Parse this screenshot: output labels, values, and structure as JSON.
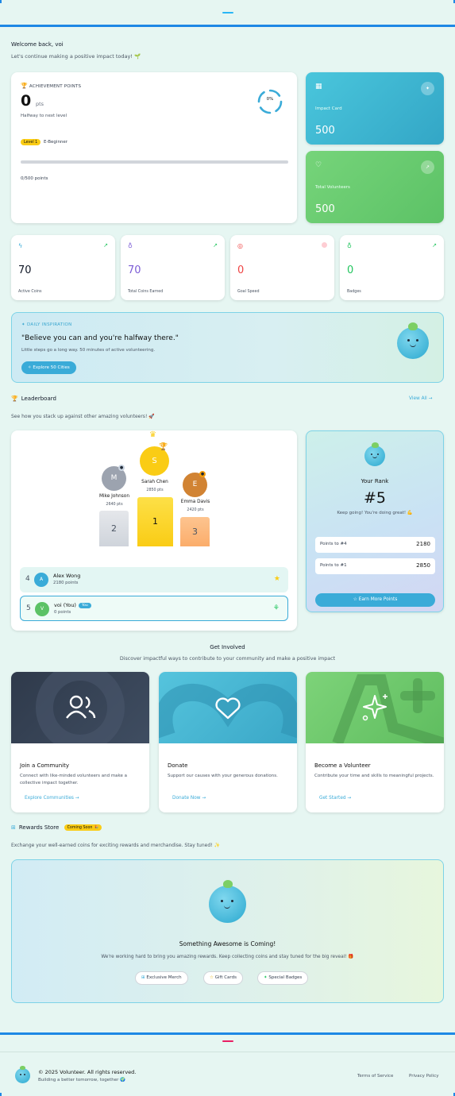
{
  "header": {},
  "welcome": {
    "title": "Welcome back, voi",
    "subtitle": "Let's continue making a positive impact today! 🌱"
  },
  "achievement": {
    "label": "ACHIEVEMENT POINTS",
    "value": "0",
    "unit": "pts",
    "caption": "Halfway to next level",
    "ring_text": "0%",
    "level_badge": "Level 1",
    "level_name": "E-Beginner",
    "progress_fraction": 0,
    "progress_text": "0/500 points"
  },
  "impact_card": {
    "label": "Impact Card",
    "value": "500"
  },
  "volunteers_card": {
    "label": "Total Volunteers",
    "value": "500"
  },
  "stats": [
    {
      "label": "Active Coins",
      "value": "70",
      "icon": "bolt-icon",
      "color": "#111827"
    },
    {
      "label": "Total Coins Earned",
      "value": "70",
      "icon": "medal-icon",
      "color": "#7c5cd6"
    },
    {
      "label": "Goal Speed",
      "value": "0",
      "icon": "target-icon",
      "color": "#ef4444"
    },
    {
      "label": "Badges",
      "value": "0",
      "icon": "award-icon",
      "color": "#22c55e"
    }
  ],
  "inspiration": {
    "tag": "DAILY INSPIRATION",
    "quote": "\"Believe you can and you're halfway there.\"",
    "subtext": "Little steps go a long way. 50 minutes of active volunteering.",
    "button": "Explore 50 Cities"
  },
  "leaderboard": {
    "title": "Leaderboard",
    "view_all": "View All",
    "subtitle": "See how you stack up against other amazing volunteers! 🚀",
    "podium": [
      {
        "initial": "M",
        "name": "Mike Johnson",
        "points": "2640 pts",
        "rank": "2"
      },
      {
        "initial": "S",
        "name": "Sarah Chen",
        "points": "2850 pts",
        "rank": "1"
      },
      {
        "initial": "E",
        "name": "Emma Davis",
        "points": "2420 pts",
        "rank": "3"
      }
    ],
    "rows": [
      {
        "rank": "4",
        "initial": "A",
        "name": "Alex Wong",
        "points": "2180 points"
      },
      {
        "rank": "5",
        "initial": "V",
        "name": "voi (You)",
        "points": "0 points",
        "badge": "You"
      }
    ]
  },
  "your_rank": {
    "title": "Your Rank",
    "rank": "#5",
    "message": "Keep going! You're doing great! 💪",
    "to4_label": "Points to #4",
    "to4_value": "2180",
    "to1_label": "Points to #1",
    "to1_value": "2850",
    "button": "Earn More Points"
  },
  "get_involved": {
    "title": "Get Involved",
    "subtitle": "Discover impactful ways to contribute to your community and make a positive impact",
    "cards": [
      {
        "title": "Join a Community",
        "desc": "Connect with like-minded volunteers and make a collective impact together.",
        "link": "Explore Communities"
      },
      {
        "title": "Donate",
        "desc": "Support our causes with your generous donations.",
        "link": "Donate Now"
      },
      {
        "title": "Become a Volunteer",
        "desc": "Contribute your time and skills to meaningful projects.",
        "link": "Get Started"
      }
    ]
  },
  "rewards": {
    "title": "Rewards Store",
    "badge": "Coming Soon 🎉",
    "subtitle": "Exchange your well-earned coins for exciting rewards and merchandise. Stay tuned! ✨",
    "heading": "Something Awesome is Coming!",
    "text": "We're working hard to bring you amazing rewards. Keep collecting coins and stay tuned for the big reveal! 🎁",
    "chips": [
      "Exclusive Merch",
      "Gift Cards",
      "Special Badges"
    ]
  },
  "footer": {
    "copyright": "© 2025 Volunteer. All rights reserved.",
    "tagline": "Building a better tomorrow, together 🌍",
    "terms": "Terms of Service",
    "privacy": "Privacy Policy"
  }
}
